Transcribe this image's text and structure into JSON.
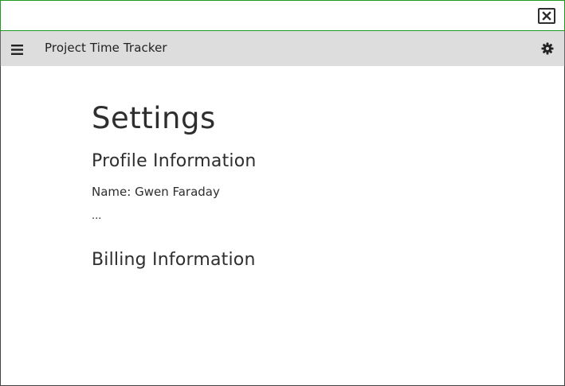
{
  "window": {
    "close_icon": "close-icon"
  },
  "app_bar": {
    "title": "Project Time Tracker",
    "menu_icon": "hamburger-menu-icon",
    "settings_icon": "gear-icon"
  },
  "main": {
    "page_title": "Settings",
    "profile": {
      "heading": "Profile Information",
      "name_line": "Name: Gwen Faraday",
      "more": "..."
    },
    "billing": {
      "heading": "Billing Information"
    }
  },
  "colors": {
    "topbar_border": "#1f9a1f",
    "appbar_bg": "#dddddd",
    "text": "#2e2e2e"
  }
}
